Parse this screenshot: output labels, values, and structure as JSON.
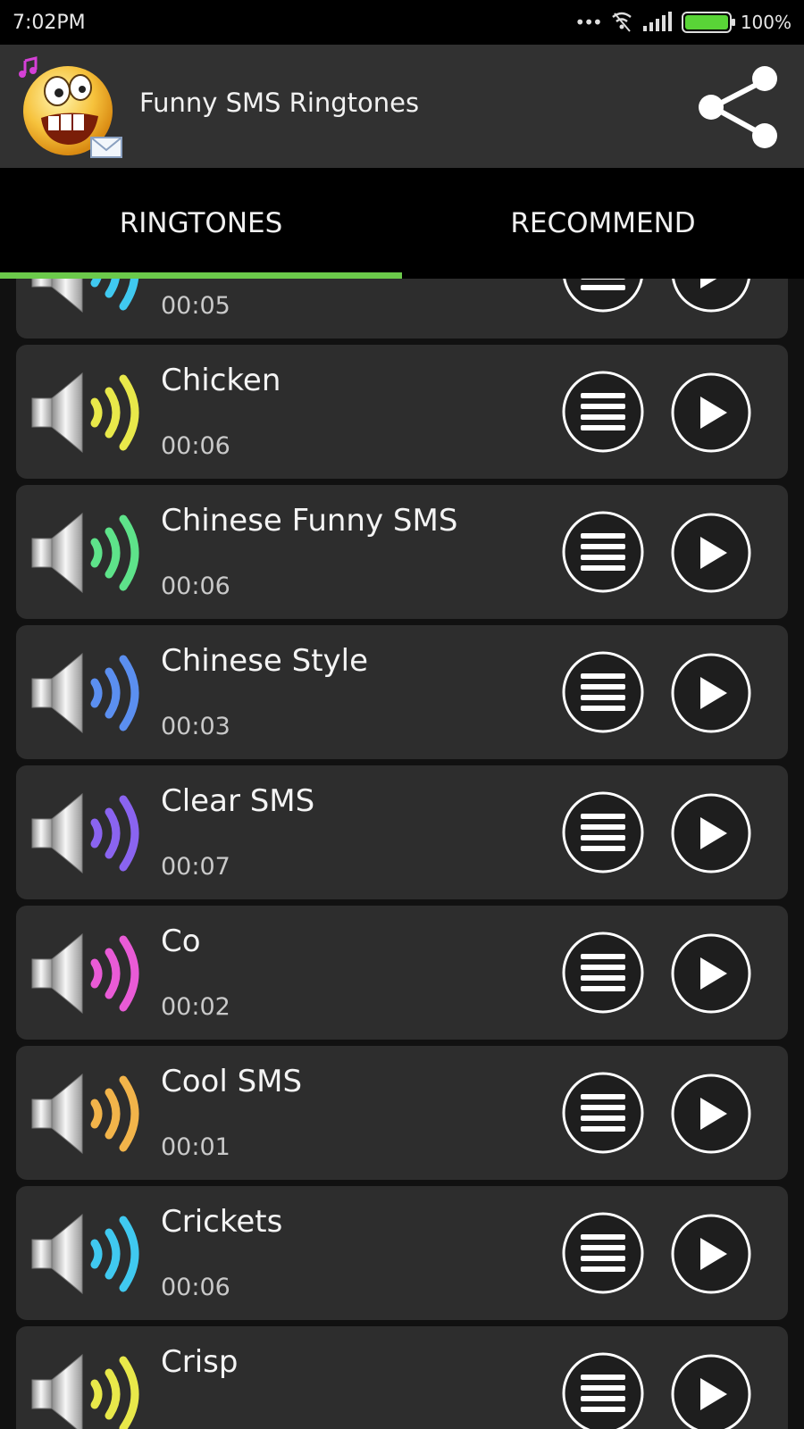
{
  "status": {
    "time": "7:02PM",
    "battery": "100%",
    "battery_level": 1.0,
    "battery_color": "#59d437"
  },
  "app": {
    "title": "Funny SMS Ringtones"
  },
  "tabs": [
    {
      "label": "RINGTONES",
      "selected": true
    },
    {
      "label": "RECOMMEND",
      "selected": false
    }
  ],
  "accent": "#6bc94a",
  "ringtones": [
    {
      "title": "",
      "duration": "00:05",
      "color": "#40c9f0"
    },
    {
      "title": "Chicken",
      "duration": "00:06",
      "color": "#e8e84a"
    },
    {
      "title": "Chinese Funny SMS",
      "duration": "00:06",
      "color": "#5ee38a"
    },
    {
      "title": "Chinese Style",
      "duration": "00:03",
      "color": "#5b8ff0"
    },
    {
      "title": "Clear SMS",
      "duration": "00:07",
      "color": "#8a64f0"
    },
    {
      "title": "Co",
      "duration": "00:02",
      "color": "#e95bd6"
    },
    {
      "title": "Cool SMS",
      "duration": "00:01",
      "color": "#f2b44a"
    },
    {
      "title": "Crickets",
      "duration": "00:06",
      "color": "#40c9f0"
    },
    {
      "title": "Crisp",
      "duration": "",
      "color": "#e8e84a"
    }
  ]
}
